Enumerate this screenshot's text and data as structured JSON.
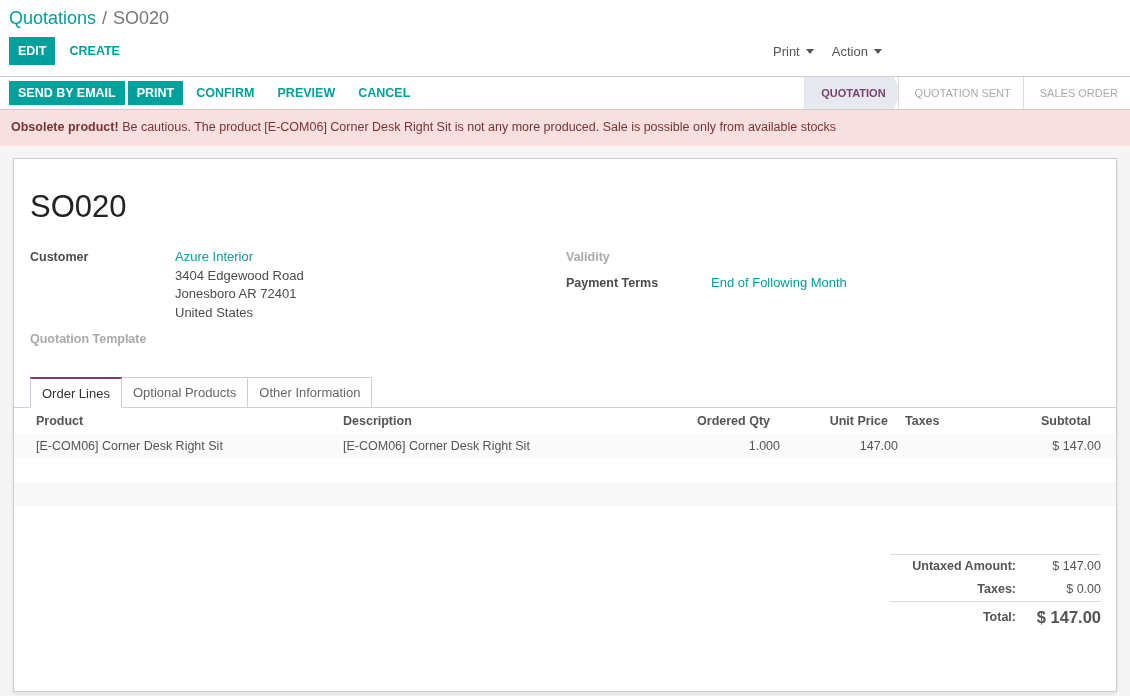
{
  "breadcrumb": {
    "items": [
      {
        "label": "Quotations",
        "kind": "link"
      },
      {
        "label": "SO020",
        "kind": "current"
      }
    ],
    "separator": "/"
  },
  "control_buttons": [
    {
      "label": "EDIT",
      "kind": "primary"
    },
    {
      "label": "CREATE",
      "kind": "link"
    }
  ],
  "dropdowns": [
    {
      "label": "Print"
    },
    {
      "label": "Action"
    }
  ],
  "action_buttons": [
    {
      "label": "SEND BY EMAIL",
      "kind": "primary"
    },
    {
      "label": "PRINT",
      "kind": "primary"
    },
    {
      "label": "CONFIRM",
      "kind": "link"
    },
    {
      "label": "PREVIEW",
      "kind": "link"
    },
    {
      "label": "CANCEL",
      "kind": "link"
    }
  ],
  "stages": [
    {
      "label": "QUOTATION",
      "selected": true
    },
    {
      "label": "QUOTATION SENT",
      "selected": false
    },
    {
      "label": "SALES ORDER",
      "selected": false
    }
  ],
  "alert": "**Obsolete product!** Be cautious. The product [E-COM06] Corner Desk Right Sit is not any more produced. Sale is possible only from available stocks",
  "form": {
    "title": "SO020",
    "left_fields": [
      {
        "label": "Customer",
        "values": [
          {
            "text": "Azure Interior",
            "kind": "link"
          },
          {
            "text": "3404 Edgewood Road",
            "kind": "text"
          },
          {
            "text": "Jonesboro AR 72401",
            "kind": "text"
          },
          {
            "text": "United States",
            "kind": "text"
          }
        ]
      },
      {
        "label": "Quotation Template"
      }
    ],
    "right_fields": [
      {
        "label": "Validity"
      },
      {
        "label": "Payment Terms",
        "values": [
          {
            "text": "End of Following Month",
            "kind": "link"
          }
        ]
      }
    ],
    "tabs": [
      {
        "label": "Order Lines",
        "selected": true
      },
      {
        "label": "Optional Products",
        "selected": false
      },
      {
        "label": "Other Information",
        "selected": false
      }
    ],
    "table": {
      "columns": [
        {
          "label": "Product",
          "kind": "text"
        },
        {
          "label": "Description",
          "kind": "text"
        },
        {
          "label": "Ordered Qty",
          "kind": "number"
        },
        {
          "label": "Unit Price",
          "kind": "number"
        },
        {
          "label": "Taxes",
          "kind": "text"
        },
        {
          "label": "Subtotal",
          "kind": "number"
        }
      ],
      "rows": [
        [
          "[E-COM06] Corner Desk Right Sit",
          "[E-COM06] Corner Desk Right Sit",
          "1.000",
          "147.00",
          null,
          "$ 147.00"
        ]
      ]
    },
    "totals": [
      {
        "label": "Untaxed Amount:",
        "value": "$ 147.00",
        "kind": "line"
      },
      {
        "label": "Taxes:",
        "value": "$ 0.00",
        "kind": "line"
      },
      {
        "label": "Total:",
        "value": "$ 147.00",
        "kind": "grand"
      }
    ]
  }
}
